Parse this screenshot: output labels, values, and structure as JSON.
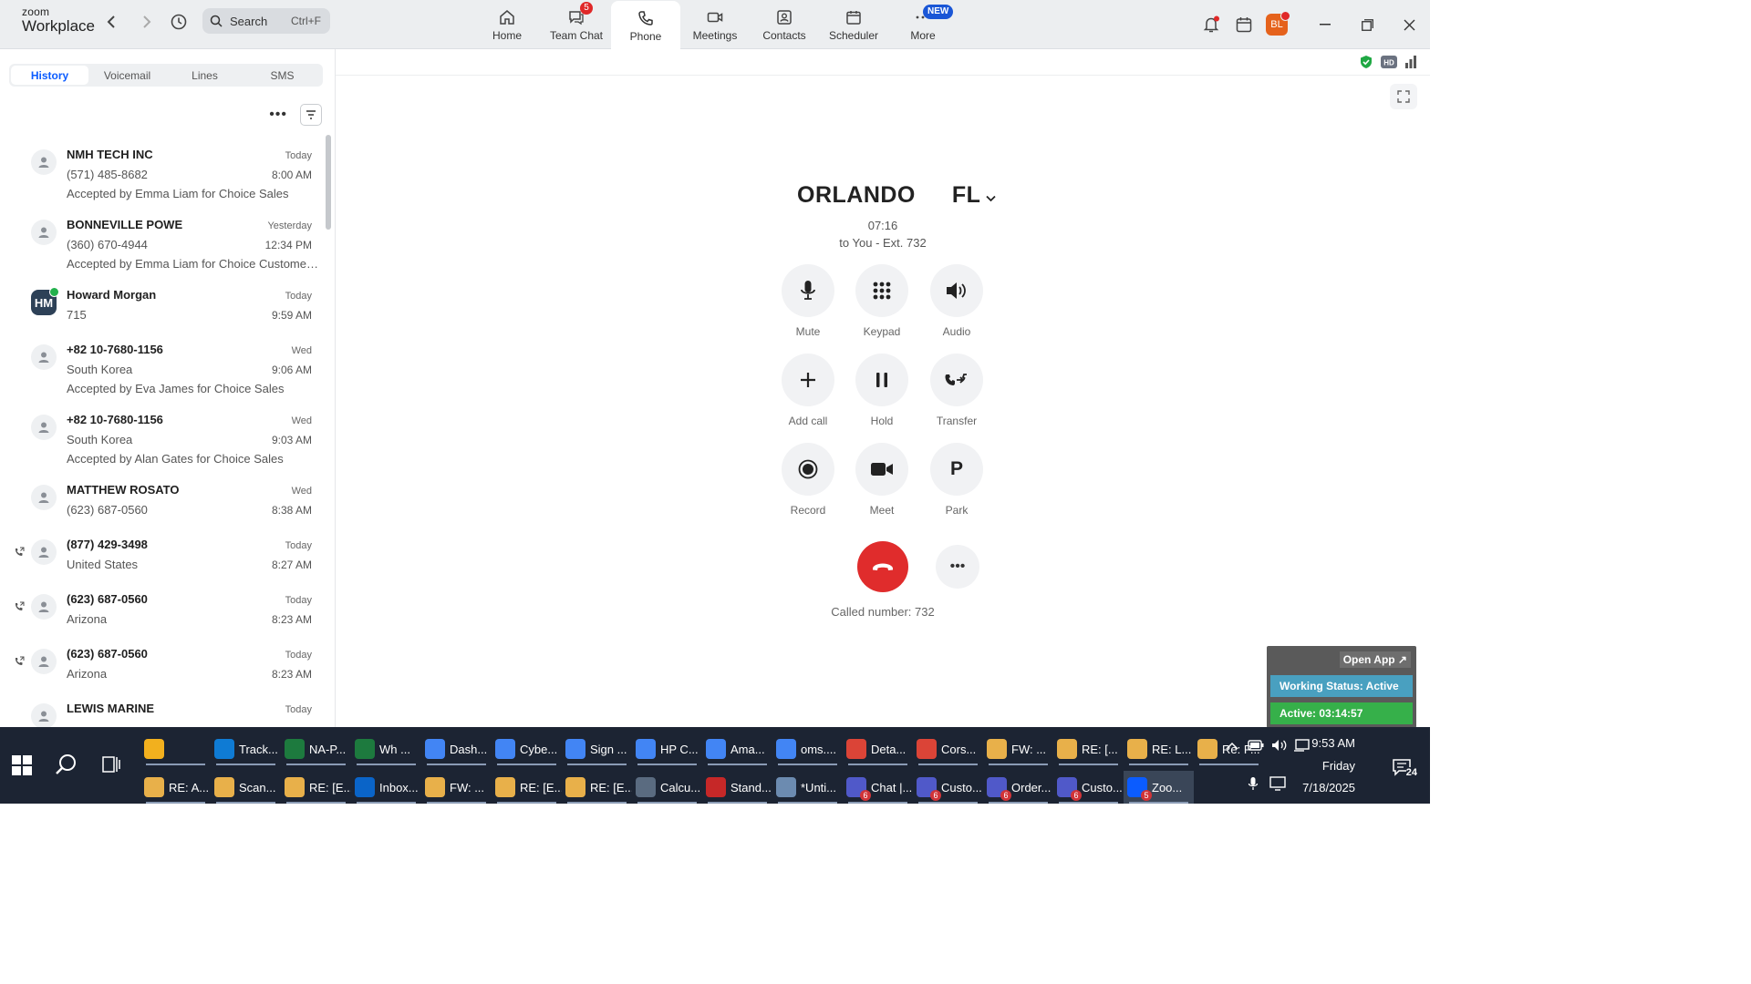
{
  "app": {
    "logo_line1": "zoom",
    "logo_line2": "Workplace",
    "search_placeholder": "Search",
    "search_shortcut": "Ctrl+F",
    "avatar_initials": "BL"
  },
  "nav_tabs": [
    {
      "label": "Home",
      "icon": "home-icon"
    },
    {
      "label": "Team Chat",
      "icon": "chat-icon",
      "badge": "5"
    },
    {
      "label": "Phone",
      "icon": "phone-icon",
      "active": true
    },
    {
      "label": "Meetings",
      "icon": "video-icon"
    },
    {
      "label": "Contacts",
      "icon": "contacts-icon"
    },
    {
      "label": "Scheduler",
      "icon": "calendar-icon"
    },
    {
      "label": "More",
      "icon": "more-icon",
      "new_badge": "NEW"
    }
  ],
  "phone_tabs": [
    "History",
    "Voicemail",
    "Lines",
    "SMS"
  ],
  "history": [
    {
      "name": "NMH TECH INC",
      "sub": "(571) 485-8682",
      "note": "Accepted by Emma Liam for Choice Sales",
      "day": "Today",
      "time": "8:00 AM"
    },
    {
      "name": "BONNEVILLE POWE",
      "sub": "(360) 670-4944",
      "note": "Accepted by Emma Liam for Choice Customer S...",
      "day": "Yesterday",
      "time": "12:34 PM"
    },
    {
      "name": "Howard Morgan",
      "sub": "715",
      "note": "",
      "day": "Today",
      "time": "9:59 AM",
      "initials": "HM"
    },
    {
      "name": "+82 10-7680-1156",
      "sub": "South Korea",
      "note": "Accepted by Eva James for Choice Sales",
      "day": "Wed",
      "time": "9:06 AM"
    },
    {
      "name": "+82 10-7680-1156",
      "sub": "South Korea",
      "note": "Accepted by Alan Gates for Choice Sales",
      "day": "Wed",
      "time": "9:03 AM"
    },
    {
      "name": "MATTHEW ROSATO",
      "sub": "(623) 687-0560",
      "note": "",
      "day": "Wed",
      "time": "8:38 AM"
    },
    {
      "name": "(877) 429-3498",
      "sub": "United States",
      "note": "",
      "day": "Today",
      "time": "8:27 AM"
    },
    {
      "name": "(623) 687-0560",
      "sub": "Arizona",
      "note": "",
      "day": "Today",
      "time": "8:23 AM"
    },
    {
      "name": "(623) 687-0560",
      "sub": "Arizona",
      "note": "",
      "day": "Today",
      "time": "8:23 AM"
    },
    {
      "name": "LEWIS MARINE",
      "sub": "",
      "note": "",
      "day": "Today",
      "time": ""
    }
  ],
  "call": {
    "city": "ORLANDO",
    "state": "FL",
    "duration": "07:16",
    "to": "to You - Ext. 732",
    "called_number": "Called number: 732",
    "controls": [
      "Mute",
      "Keypad",
      "Audio",
      "Add call",
      "Hold",
      "Transfer",
      "Record",
      "Meet",
      "Park"
    ],
    "park_letter": "P"
  },
  "widget": {
    "open_app": "Open App ↗",
    "working_status": "Working Status: Active",
    "active_timer": "Active: 03:14:57"
  },
  "taskbar": {
    "row1": [
      {
        "label": "",
        "color": "#f2b01e"
      },
      {
        "label": "Track...",
        "color": "#0f7bd4"
      },
      {
        "label": "NA-P...",
        "color": "#1d7a3e"
      },
      {
        "label": "Wh ...",
        "color": "#1d7a3e"
      },
      {
        "label": "Dash...",
        "color": "#4285f4"
      },
      {
        "label": "Cybe...",
        "color": "#4285f4"
      },
      {
        "label": "Sign ...",
        "color": "#4285f4"
      },
      {
        "label": "HP C...",
        "color": "#4285f4"
      },
      {
        "label": "Ama...",
        "color": "#4285f4"
      },
      {
        "label": "oms....",
        "color": "#4285f4"
      },
      {
        "label": "Deta...",
        "color": "#db4437"
      },
      {
        "label": "Cors...",
        "color": "#db4437"
      },
      {
        "label": "FW: ...",
        "color": "#e8b04a"
      },
      {
        "label": "RE: [...",
        "color": "#e8b04a"
      },
      {
        "label": "RE: L...",
        "color": "#e8b04a"
      },
      {
        "label": "Re: P...",
        "color": "#e8b04a"
      }
    ],
    "row2": [
      {
        "label": "RE: A...",
        "color": "#e8b04a"
      },
      {
        "label": "Scan...",
        "color": "#e8b04a"
      },
      {
        "label": "RE: [E...",
        "color": "#e8b04a"
      },
      {
        "label": "Inbox...",
        "color": "#0a64c8"
      },
      {
        "label": "FW: ...",
        "color": "#e8b04a"
      },
      {
        "label": "RE: [E...",
        "color": "#e8b04a"
      },
      {
        "label": "RE: [E...",
        "color": "#e8b04a"
      },
      {
        "label": "Calcu...",
        "color": "#5a6b80"
      },
      {
        "label": "Stand...",
        "color": "#c62828"
      },
      {
        "label": "*Unti...",
        "color": "#6c8bb0"
      },
      {
        "label": "Chat |...",
        "color": "#5059c9",
        "count": "6"
      },
      {
        "label": "Custo...",
        "color": "#5059c9",
        "count": "6"
      },
      {
        "label": "Order...",
        "color": "#5059c9",
        "count": "6"
      },
      {
        "label": "Custo...",
        "color": "#5059c9",
        "count": "6"
      },
      {
        "label": "Zoo...",
        "color": "#0b5cff",
        "count": "5",
        "active": true
      }
    ],
    "time": "9:53 AM",
    "day": "Friday",
    "date": "7/18/2025",
    "notifications": "24"
  }
}
